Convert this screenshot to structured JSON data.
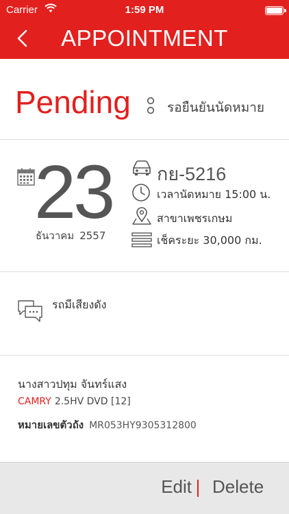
{
  "status_bar": {
    "carrier": "Carrier",
    "time": "1:59 PM"
  },
  "header": {
    "title": "APPOINTMENT",
    "back_icon": "chevron-left-icon"
  },
  "appointment_status": {
    "label": "Pending",
    "description": "รอยืนยันนัดหมาย"
  },
  "date": {
    "day": "23",
    "month": "ธันวาคม",
    "year": "2557"
  },
  "vehicle": {
    "plate": "กย-5216",
    "appointment_time": "เวลานัดหมาย  15:00  น.",
    "branch": "สาขาเพชรเกษม",
    "mileage": "เช็คระยะ  30,000  กม."
  },
  "note": {
    "text": "รถมีเสียงดัง"
  },
  "customer": {
    "name": "นางสาวปทุม  จันทร์แสง",
    "car_model": "CAMRY",
    "car_spec": "2.5HV DVD [12]",
    "chassis_label": "หมายเลขตัวถัง",
    "chassis_number": "MR053HY9305312800"
  },
  "footer": {
    "edit_label": "Edit",
    "delete_label": "Delete"
  },
  "colors": {
    "brand_red": "#e2201e",
    "footer_bg": "#e8e8e8",
    "divider": "#dedede"
  }
}
